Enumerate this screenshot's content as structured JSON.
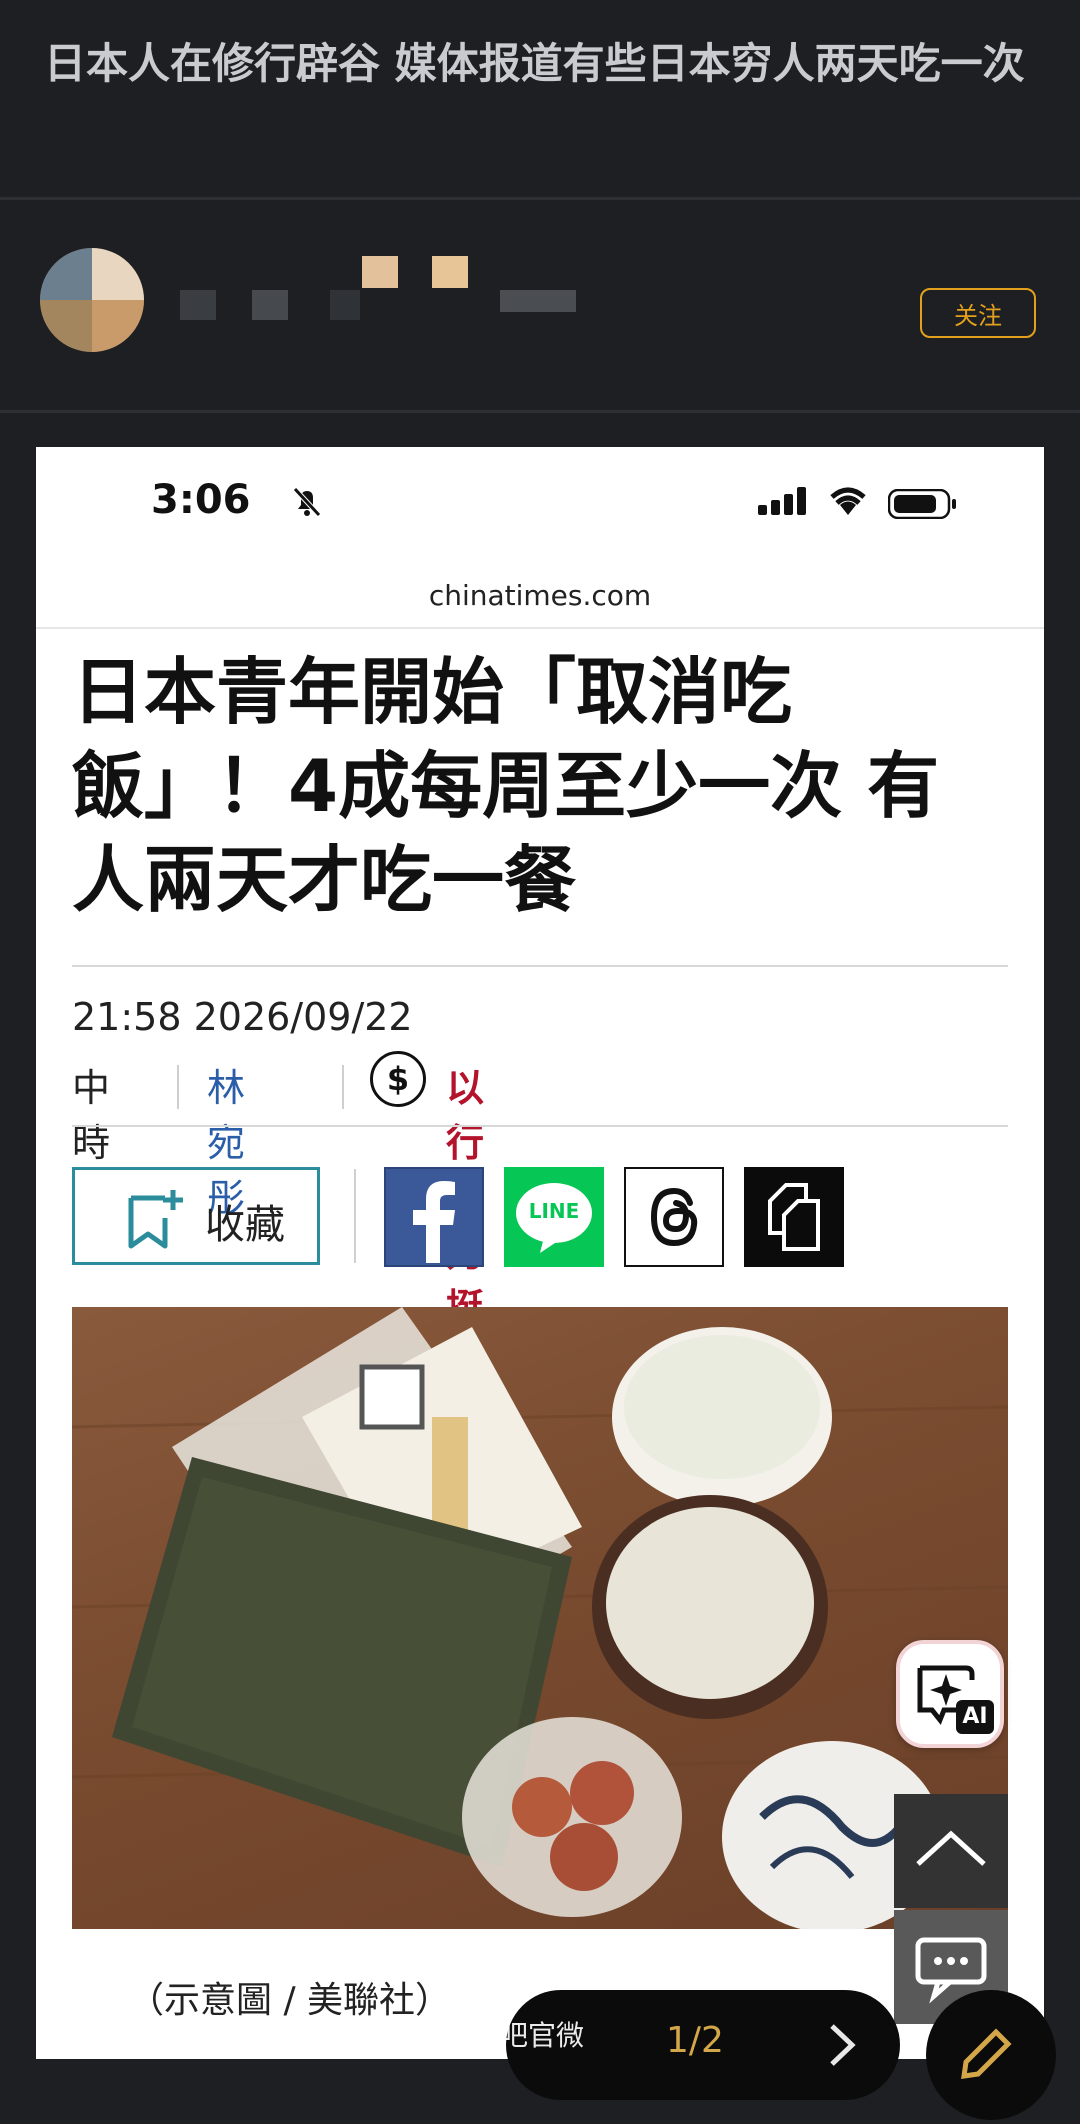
{
  "post": {
    "title": "日本人在修行辟谷 媒体报道有些日本穷人两天吃一次",
    "follow_label": "关注"
  },
  "screenshot": {
    "status_time": "3:06",
    "url": "chinatimes.com",
    "headline": "日本青年開始「取消吃飯」！4成每周至少一次 有人兩天才吃一餐",
    "datetime": "21:58  2026/09/22",
    "source": "中時",
    "author": "林宛彤",
    "support_label": "以行動力挺",
    "collect_label": "收藏",
    "share_line_label": "LINE",
    "caption": "（示意圖 / 美聯社）",
    "ai_badge": "AI",
    "colors": {
      "accent_teal": "#2b8c9c",
      "author_blue": "#2b5ea8",
      "support_red": "#b3142b",
      "facebook": "#3b5998",
      "line": "#06c755"
    }
  },
  "pager": {
    "current": "1/2"
  },
  "watermark": "@帝吧官微",
  "icons": [
    "bell-mute-icon",
    "signal-icon",
    "wifi-icon",
    "battery-icon",
    "dollar-icon",
    "bookmark-add-icon",
    "facebook-icon",
    "line-icon",
    "threads-icon",
    "copy-icon",
    "ai-sparkle-icon",
    "chevron-up-icon",
    "chat-icon",
    "chevron-right-icon",
    "edit-icon"
  ]
}
